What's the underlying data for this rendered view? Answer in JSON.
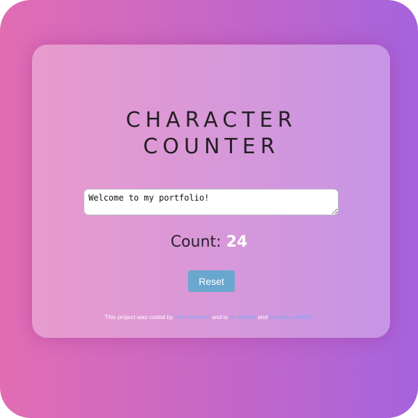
{
  "app": {
    "title_line1": "CHARACTER",
    "title_line2": "COUNTER"
  },
  "input": {
    "value": "Welcome to my portfolio!"
  },
  "counter": {
    "label": "Count:",
    "value": "24"
  },
  "actions": {
    "reset_label": "Reset"
  },
  "footer": {
    "prefix": "This project was coded by",
    "author_link": "Rita Hamilton",
    "middle": "and is",
    "source_link": "on GitHub",
    "conjunction": "and",
    "hosting_link": "hosted on Netlify"
  },
  "colors": {
    "gradient_start": "#e16db3",
    "gradient_end": "#a663dd",
    "button": "#6aa7cf",
    "link": "#7fa8f5"
  }
}
